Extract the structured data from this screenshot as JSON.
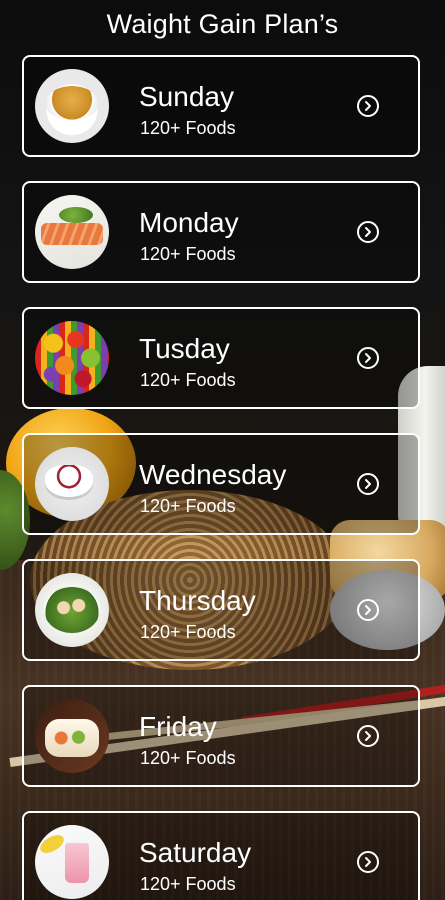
{
  "header": {
    "title": "Waight Gain Plan’s"
  },
  "days": [
    {
      "name": "Sunday",
      "count": "120+ Foods",
      "thumb_icon": "soup-bowl"
    },
    {
      "name": "Monday",
      "count": "120+ Foods",
      "thumb_icon": "salmon-plate"
    },
    {
      "name": "Tusday",
      "count": "120+ Foods",
      "thumb_icon": "fruit-mix"
    },
    {
      "name": "Wednesday",
      "count": "120+ Foods",
      "thumb_icon": "yogurt-cup"
    },
    {
      "name": "Thursday",
      "count": "120+ Foods",
      "thumb_icon": "salad-plate"
    },
    {
      "name": "Friday",
      "count": "120+ Foods",
      "thumb_icon": "wrap-roll"
    },
    {
      "name": "Saturday",
      "count": "120+ Foods",
      "thumb_icon": "smoothie-banana"
    }
  ],
  "colors": {
    "text": "#ffffff",
    "card_border": "#ffffff",
    "background": "#0c0c0c"
  }
}
